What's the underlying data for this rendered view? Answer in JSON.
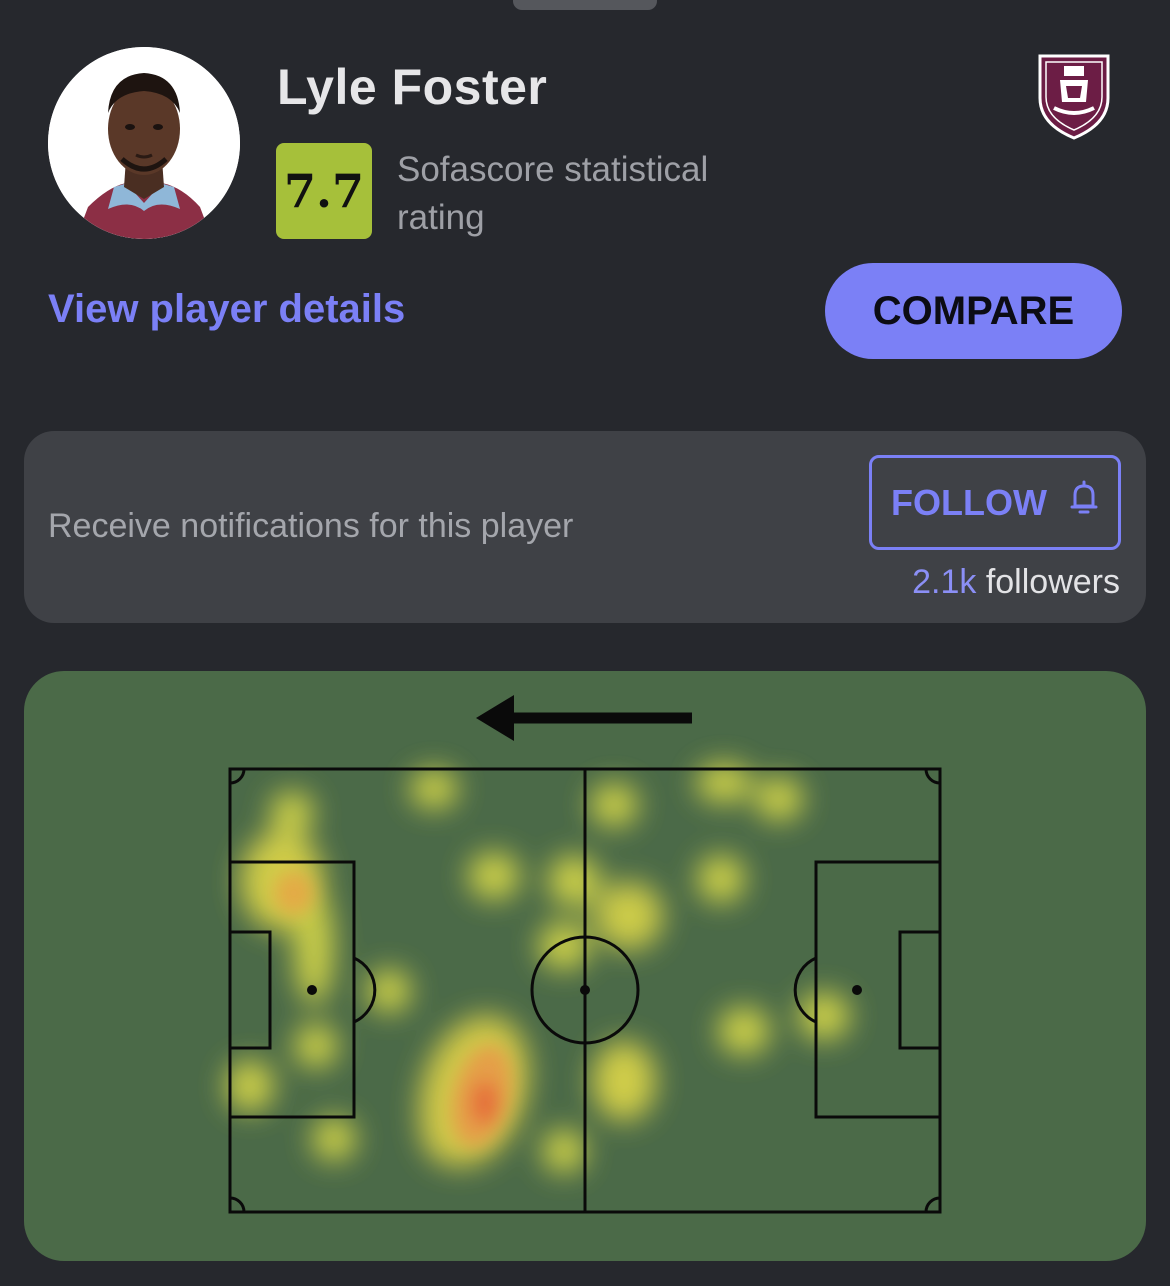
{
  "player": {
    "name": "Lyle Foster",
    "rating": "7.7",
    "rating_label": "Sofascore statistical rating",
    "rating_color": "#a6c03a"
  },
  "team": {
    "logo_icon": "burnley-crest-icon",
    "color": "#6c1d45"
  },
  "actions": {
    "details_link": "View player details",
    "compare_label": "COMPARE"
  },
  "notifications": {
    "text": "Receive notifications for this player",
    "follow_label": "FOLLOW",
    "follow_icon": "bell-icon",
    "followers_count": "2.1k",
    "followers_label": "followers"
  },
  "heatmap": {
    "direction_icon": "arrow-left-icon",
    "pitch_color": "#4b6a48"
  },
  "colors": {
    "accent": "#7b80f6",
    "background": "#26282d",
    "card": "#3f4146"
  }
}
